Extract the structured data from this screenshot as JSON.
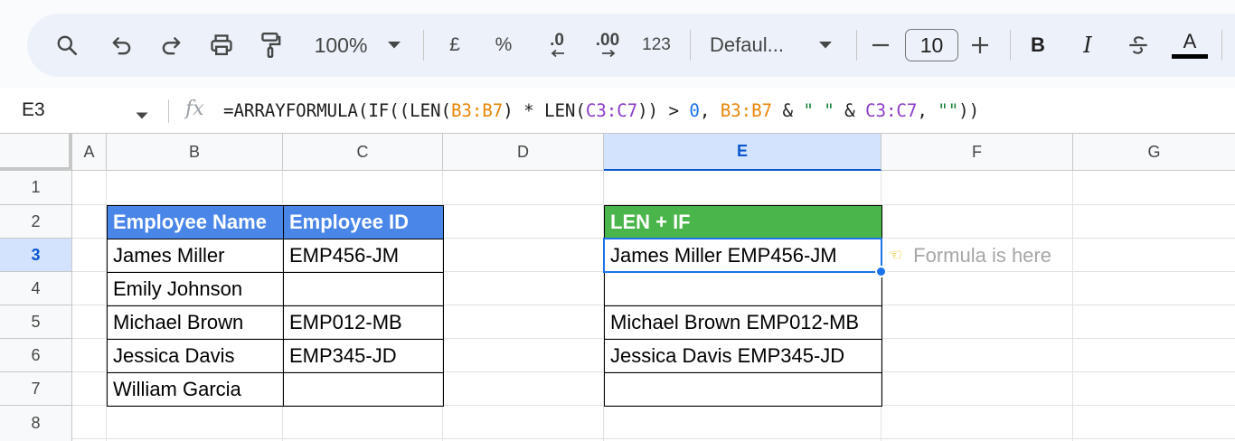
{
  "toolbar": {
    "zoom": "100%",
    "currency": "£",
    "percent": "%",
    "decrease_decimals": ".0",
    "increase_decimals": ".00",
    "number_format": "123",
    "font_family": "Defaul...",
    "font_size": "10",
    "bold": "B",
    "italic": "I",
    "text_color": "A"
  },
  "formula_bar": {
    "name_box": "E3",
    "fx_label": "fx",
    "formula_parts": [
      "=ARRAYFORMULA(IF((LEN(",
      "B3:B7",
      ") * LEN(",
      "C3:C7",
      ")) > ",
      "0",
      ", ",
      "B3:B7",
      " & ",
      "\" \"",
      " & ",
      "C3:C7",
      ", ",
      "\"\"",
      "))"
    ]
  },
  "columns": [
    "A",
    "B",
    "C",
    "D",
    "E",
    "F",
    "G"
  ],
  "selected_column": "E",
  "rows": [
    "1",
    "2",
    "3",
    "4",
    "5",
    "6",
    "7",
    "8"
  ],
  "selected_row": "3",
  "table1": {
    "headers": [
      "Employee Name",
      "Employee ID"
    ],
    "rows": [
      [
        "James Miller",
        "EMP456-JM"
      ],
      [
        "Emily Johnson",
        ""
      ],
      [
        "Michael Brown",
        "EMP012-MB"
      ],
      [
        "Jessica Davis",
        "EMP345-JD"
      ],
      [
        "William Garcia",
        ""
      ]
    ]
  },
  "table2": {
    "header": "LEN + IF",
    "rows": [
      "James Miller EMP456-JM",
      "",
      "Michael Brown EMP012-MB",
      "Jessica Davis EMP345-JD",
      ""
    ]
  },
  "note": "Formula is here",
  "colors": {
    "header_blue": "#4a86e8",
    "header_green": "#4ab54a",
    "selection": "#1a73e8",
    "range_orange": "#e8850a",
    "range_purple": "#8b3cc7"
  }
}
